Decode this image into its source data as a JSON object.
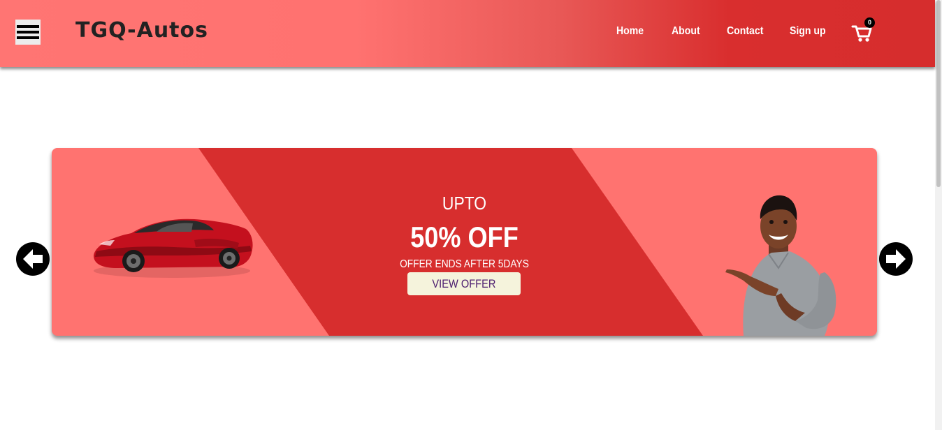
{
  "header": {
    "logo": "TGQ-Autos",
    "nav": [
      {
        "label": "Home"
      },
      {
        "label": "About"
      },
      {
        "label": "Contact"
      },
      {
        "label": "Sign up"
      }
    ],
    "cart_count": "0",
    "icons": {
      "menu": "hamburger-icon",
      "cart": "cart-icon"
    }
  },
  "slider": {
    "upto": "UPTO",
    "discount": "50% OFF",
    "offer_ends": "OFFER ENDS AFTER 5DAYS",
    "cta": "VIEW OFFER",
    "prev_icon": "arrow-left-icon",
    "next_icon": "arrow-right-icon"
  },
  "colors": {
    "header_light": "#ff7573",
    "header_dark": "#d62d2d",
    "banner_light": "#ff7370",
    "banner_stripe": "#d72e2e",
    "cta_bg": "#f5f3dc",
    "cta_text": "#4b1c6e"
  }
}
